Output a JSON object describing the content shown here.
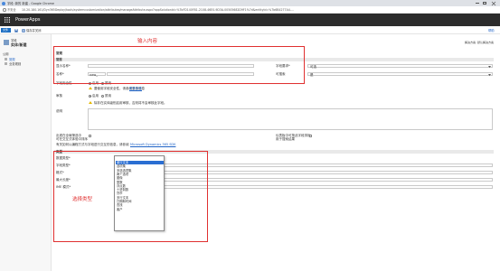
{
  "browser": {
    "tab_title": "字段: 新的 新建 - Google Chrome",
    "secure_label": "不安全",
    "url": "10.20.180.161/Dyn365Deploy/tools/systemcustomization/attributes/manageAttribute.aspx?appSolutionId=%7bFD140F81-2108-46E0-9D3A-00505682D9F1%7d&entityId=%7b6B4277A4-..."
  },
  "app": {
    "name": "PowerApps"
  },
  "command_bar": {
    "save_close_label": "保存并关闭",
    "help_label": "帮助",
    "file_label": "文件"
  },
  "nav": {
    "entity_title": "字段",
    "entity_subtitle": "实体/新建",
    "group_label": "公用",
    "items": [
      {
        "label": "常规"
      },
      {
        "label": "业务规则"
      }
    ]
  },
  "form": {
    "section_general": "常规",
    "solution_label": "解决方案: 默认解决方案",
    "section_general2": "常规",
    "schema_label": "显示名称*",
    "display_name_value": "",
    "field_requirement_label": "字段要求*",
    "field_requirement_value": "可选",
    "name_label": "名称*",
    "name_prefix_value": "new_",
    "searchable_label": "可搜索",
    "searchable_value": "是",
    "field_security_label": "字段安全性",
    "enable_label": "启用",
    "disable_label": "禁用",
    "security_warning": "要使用字段安全性，请参阅更多信息",
    "security_link": "更多信息",
    "auditing_label": "审核",
    "auditing_enable": "启用",
    "auditing_disable": "禁用",
    "audit_warning": "除非在实体级别启用审核，否则将不会审核此字段。",
    "description_label": "说明",
    "sync_label_1": "出现在全局筛选中",
    "sync_label_2": "可在交互式体验中排序",
    "sync_label_3": "仪表板中可按此字段排序",
    "sync_label_4": "用于搜索结果",
    "note_text": "有关如何以编程方式与字段进行交互的信息，请参阅",
    "note_link": "Microsoft Dynamics 365 SDK",
    "type_section": "类型",
    "data_type_label": "数据类型*",
    "field_type_label": "字段类型*",
    "format_label": "格式*",
    "max_length_label": "最大长度*",
    "ime_label": "IME 模式*"
  },
  "dropdown": {
    "selected_value": "单行文本",
    "options": [
      "单行文本",
      "选项集",
      "多选选项集",
      "两个选项",
      "图像",
      "整数",
      "浮点数",
      "十进制数",
      "货币",
      "多行文本",
      "日期和时间",
      "查找",
      "客户"
    ]
  },
  "annotations": {
    "input_content": "输入内容",
    "select_type": "选择类型"
  },
  "colors": {
    "annotation_red": "#e03030",
    "header_dark": "#2c2c2c",
    "selected_blue": "#2a6ed2",
    "link_blue": "#1f63c6",
    "warning_yellow": "#e6b800"
  }
}
